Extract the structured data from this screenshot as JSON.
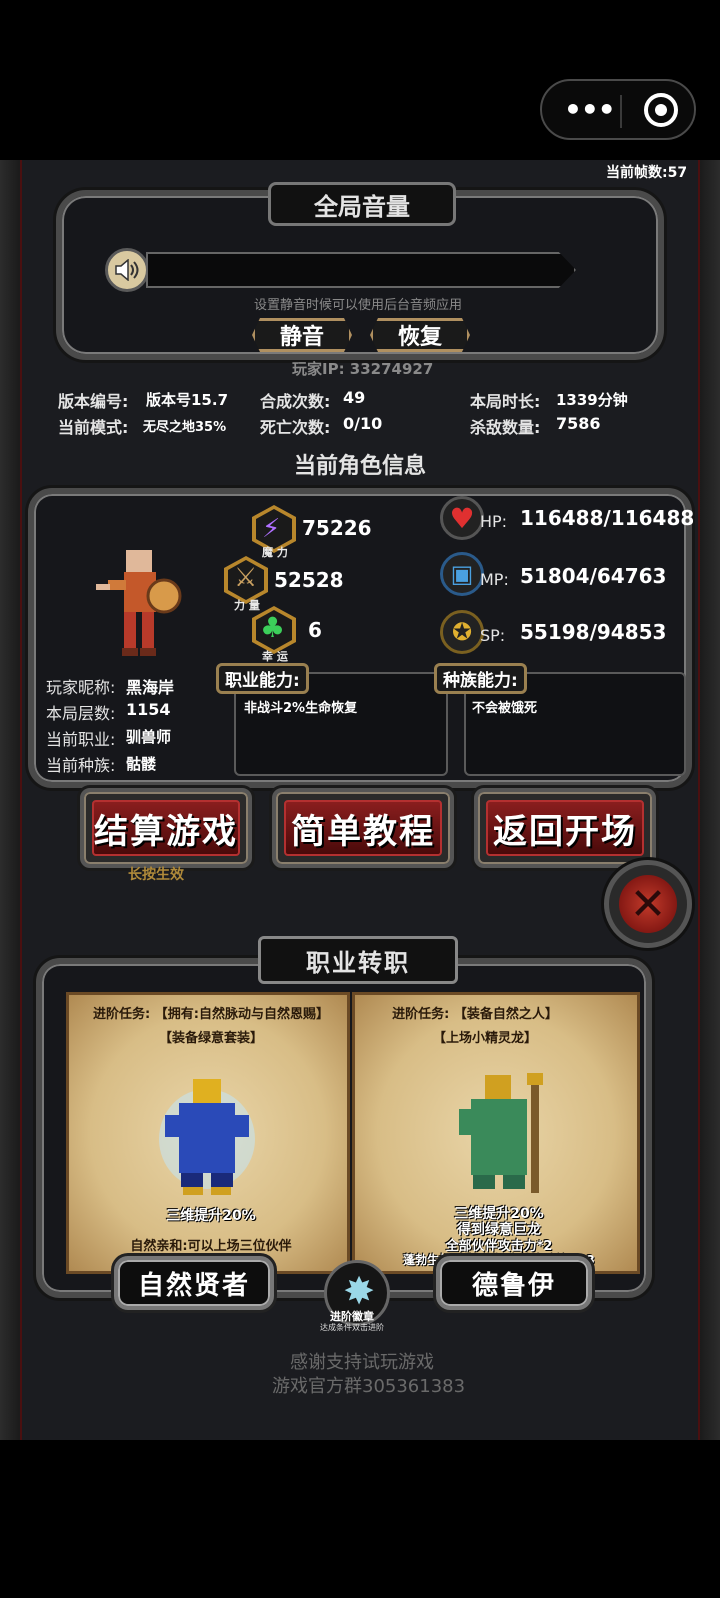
{
  "fps": "当前帧数:57",
  "volume": {
    "title": "全局音量",
    "hint": "设置静音时候可以使用后台音频应用",
    "mute_label": "静音",
    "restore_label": "恢复"
  },
  "player_ip": "玩家IP:  33274927",
  "stats": {
    "version_label": "版本编号:",
    "version_value": "版本号15.7",
    "mode_label": "当前模式:",
    "mode_value": "无尽之地35%",
    "synth_label": "合成次数:",
    "synth_value": "49",
    "death_label": "死亡次数:",
    "death_value": "0/10",
    "time_label": "本局时长:",
    "time_value": "1339分钟",
    "kills_label": "杀敌数量:",
    "kills_value": "7586"
  },
  "char": {
    "section_title": "当前角色信息",
    "magic": "75226",
    "magic_label": "魔 力",
    "power": "52528",
    "power_label": "力 量",
    "luck": "6",
    "luck_label": "幸 运",
    "hp_label": "HP:",
    "hp": "116488/116488",
    "mp_label": "MP:",
    "mp": "51804/64763",
    "sp_label": "SP:",
    "sp": "55198/94853",
    "nick_label": "玩家昵称:",
    "nick": "黑海岸",
    "floor_label": "本局层数:",
    "floor": "1154",
    "job_label": "当前职业:",
    "job": "驯兽师",
    "race_label": "当前种族:",
    "race": "骷髅",
    "job_ability_label": "职业能力:",
    "job_ability": "非战斗2%生命恢复",
    "race_ability_label": "种族能力:",
    "race_ability": "不会被饿死"
  },
  "buttons": {
    "settle": "结算游戏",
    "settle_hint": "长按生效",
    "tutorial": "简单教程",
    "back": "返回开场"
  },
  "transfer": {
    "title": "职业转职",
    "left": {
      "task1": "进阶任务:  【拥有:自然脉动与自然恩赐】",
      "task2": "【装备绿意套装】",
      "effect1": "三维提升20%",
      "effect2": "自然亲和:可以上场三位伙伴",
      "name": "自然贤者"
    },
    "right": {
      "task1": "进阶任务:  【装备自然之人】",
      "task2": "【上场小精灵龙】",
      "effect1": "三维提升20%",
      "effect2": "得到绿意巨龙",
      "effect3": "全部伙伴攻击力*2",
      "effect4": "蓬勃生机,自然之人,自然脉动效果*3",
      "name": "德鲁伊"
    },
    "badge_label": "进阶徽章",
    "badge_hint": "达成条件双击进阶"
  },
  "footer": {
    "line1": "感谢支持试玩游戏",
    "line2": "游戏官方群305361383"
  },
  "colors": {
    "accent_red": "#8a1e1e",
    "gold": "#b8872c",
    "parchment": "#e2cb98"
  }
}
